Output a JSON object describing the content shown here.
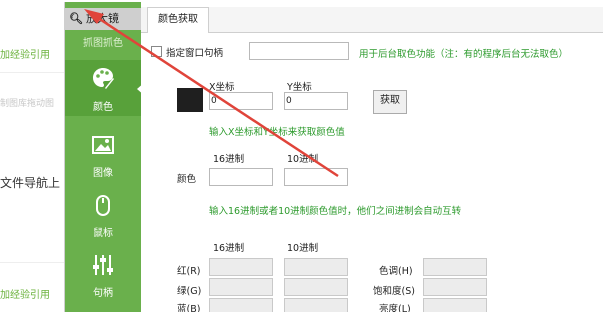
{
  "background": {
    "lines": [
      {
        "text": "加经验引用",
        "kind": "green"
      },
      {
        "text": "制图库拖动图",
        "kind": "faint"
      },
      {
        "text": "文件导航上",
        "kind": "dark"
      },
      {
        "text": "加经验引用",
        "kind": "green"
      }
    ]
  },
  "sidebar": {
    "magnifier_label": "放大镜",
    "magnifier_icon": "search-icon",
    "capture_header": "抓图抓色",
    "items": [
      {
        "label": "颜色",
        "icon": "palette-icon",
        "active": true
      },
      {
        "label": "图像",
        "icon": "image-icon",
        "active": false
      },
      {
        "label": "鼠标",
        "icon": "mouse-icon",
        "active": false
      },
      {
        "label": "句柄",
        "icon": "sliders-icon",
        "active": false
      }
    ]
  },
  "tabs": [
    {
      "label": "颜色获取"
    }
  ],
  "window_handle": {
    "checkbox_label": "指定窗口句柄",
    "checked": false,
    "value": "",
    "note": "用于后台取色功能（注：有的程序后台无法取色）"
  },
  "coords": {
    "x_label": "X坐标",
    "y_label": "Y坐标",
    "x_value": "0",
    "y_value": "0",
    "button_label": "获取",
    "hint": "输入X坐标和Y坐标来获取颜色值",
    "swatch_color": "#1f1f1f"
  },
  "color_codes": {
    "hex_label": "16进制",
    "dec_label": "10进制",
    "row_label": "颜色",
    "hex_value": "",
    "dec_value": "",
    "hint": "输入16进制或者10进制颜色值时，他们之间进制会自动互转"
  },
  "components": {
    "hex_label": "16进制",
    "dec_label": "10进制",
    "rgb": [
      {
        "label": "红(R)",
        "hex": "",
        "dec": ""
      },
      {
        "label": "绿(G)",
        "hex": "",
        "dec": ""
      },
      {
        "label": "蓝(B)",
        "hex": "",
        "dec": ""
      }
    ],
    "hsl": [
      {
        "label": "色调(H)",
        "value": ""
      },
      {
        "label": "饱和度(S)",
        "value": ""
      },
      {
        "label": "亮度(L)",
        "value": ""
      }
    ]
  },
  "colors": {
    "sidebar_green": "#6ab04c",
    "hint_green": "#2c9a2c",
    "annotation_red": "#e0443a"
  }
}
